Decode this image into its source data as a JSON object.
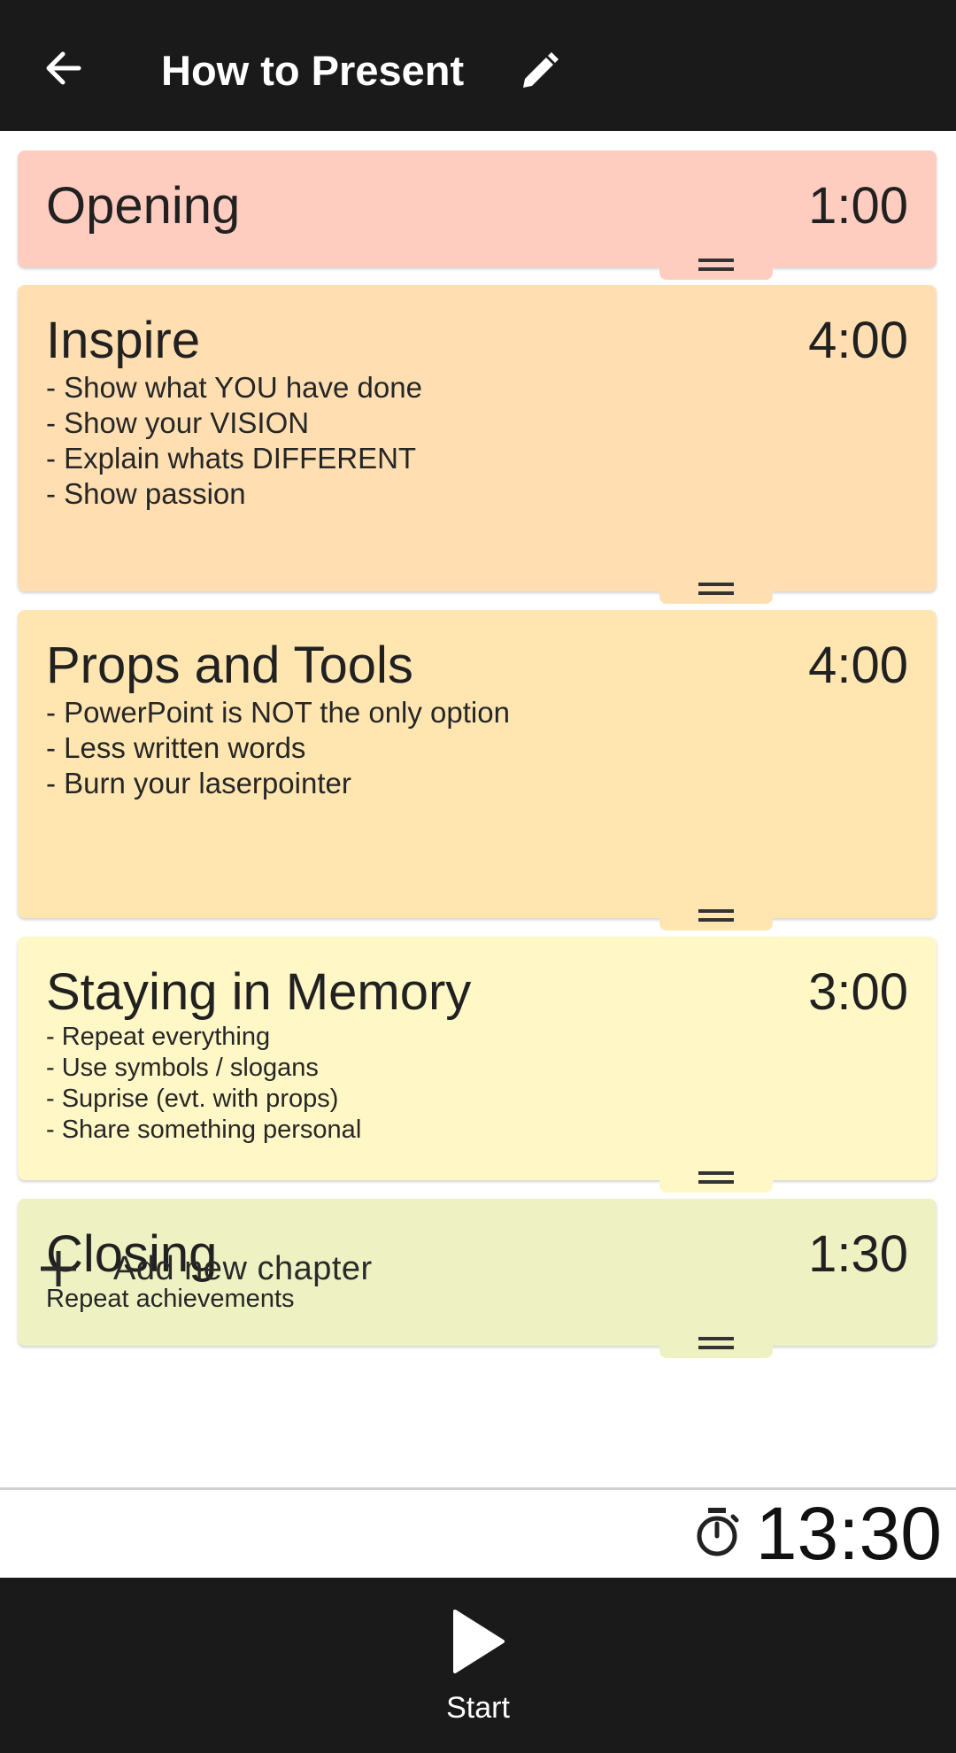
{
  "header": {
    "title": "How to Present"
  },
  "chapters": [
    {
      "title": "Opening",
      "time": "1:00",
      "notes": "",
      "color": "#FFCCC0"
    },
    {
      "title": "Inspire",
      "time": "4:00",
      "notes": "- Show what YOU have done\n- Show your VISION\n- Explain whats DIFFERENT\n- Show passion",
      "color": "#FFDFB2"
    },
    {
      "title": "Props and Tools",
      "time": "4:00",
      "notes": "- PowerPoint is NOT the only option\n- Less written words\n- Burn your laserpointer",
      "color": "#FFE6B1"
    },
    {
      "title": "Staying in Memory",
      "time": "3:00",
      "notes": "- Repeat everything\n- Use symbols / slogans\n- Suprise (evt. with props)\n- Share something personal",
      "color": "#FFF7C6"
    },
    {
      "title": "Closing",
      "time": "1:30",
      "notes": "Repeat achievements",
      "color": "#EEF2C3"
    }
  ],
  "add_chapter": {
    "label": "Add new chapter"
  },
  "total": {
    "time": "13:30"
  },
  "bottom": {
    "start_label": "Start"
  },
  "icons": {
    "back": "arrow-back-icon",
    "edit": "pencil-icon",
    "drag": "drag-handle-icon",
    "add": "plus-icon",
    "timer": "stopwatch-icon",
    "play": "play-icon"
  }
}
